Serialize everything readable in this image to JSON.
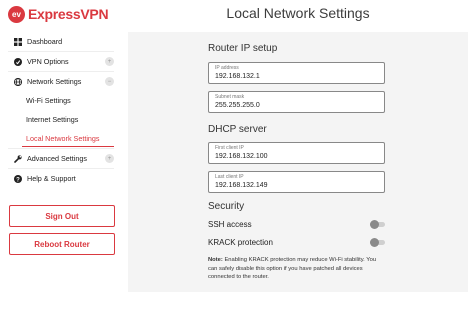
{
  "brand": {
    "logo_text": "ev",
    "name": "ExpressVPN",
    "color": "#da3940"
  },
  "page_title": "Local Network Settings",
  "sidebar": {
    "items": [
      {
        "label": "Dashboard",
        "icon": "grid-icon"
      },
      {
        "label": "VPN Options",
        "icon": "vpn-icon",
        "badge": "+"
      },
      {
        "label": "Network Settings",
        "icon": "globe-icon",
        "badge": "−"
      },
      {
        "label": "Wi-Fi Settings"
      },
      {
        "label": "Internet Settings"
      },
      {
        "label": "Local Network Settings",
        "active": true
      },
      {
        "label": "Advanced Settings",
        "icon": "wrench-icon",
        "badge": "+"
      },
      {
        "label": "Help & Support",
        "icon": "help-icon"
      }
    ],
    "sign_out_label": "Sign Out",
    "reboot_label": "Reboot Router"
  },
  "router_ip": {
    "title": "Router IP setup",
    "ip_label": "IP address",
    "ip_value": "192.168.132.1",
    "mask_label": "Subnet mask",
    "mask_value": "255.255.255.0"
  },
  "dhcp": {
    "title": "DHCP server",
    "first_label": "First client IP",
    "first_value": "192.168.132.100",
    "last_label": "Last client IP",
    "last_value": "192.168.132.149"
  },
  "security": {
    "title": "Security",
    "ssh_label": "SSH access",
    "ssh_enabled": false,
    "krack_label": "KRACK protection",
    "krack_enabled": false
  },
  "note": {
    "prefix": "Note:",
    "text": "Enabling KRACK protection may reduce Wi-Fi stability. You can safely disable this option if you have patched all devices connected to the router."
  }
}
